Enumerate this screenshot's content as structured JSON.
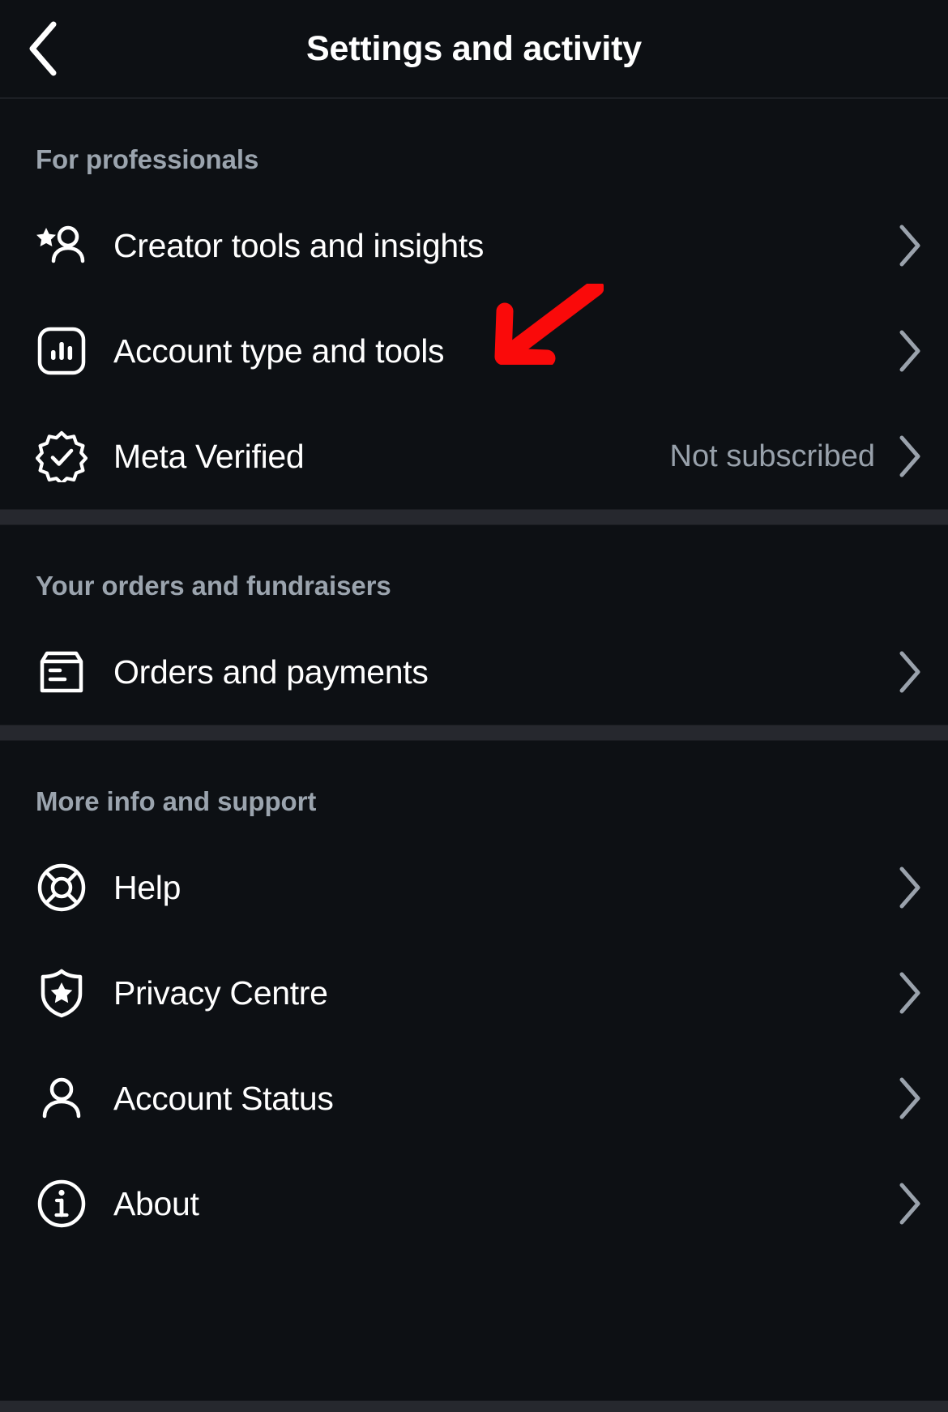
{
  "header": {
    "title": "Settings and activity",
    "back_icon": "chevron-left-icon"
  },
  "sections": [
    {
      "title": "For professionals",
      "items": [
        {
          "label": "Creator tools and insights",
          "icon": "creator-star-person-icon",
          "value": "",
          "chevron": "chevron-right-icon"
        },
        {
          "label": "Account type and tools",
          "icon": "bar-chart-square-icon",
          "value": "",
          "chevron": "chevron-right-icon"
        },
        {
          "label": "Meta Verified",
          "icon": "verified-badge-icon",
          "value": "Not subscribed",
          "chevron": "chevron-right-icon"
        }
      ]
    },
    {
      "title": "Your orders and fundraisers",
      "items": [
        {
          "label": "Orders and payments",
          "icon": "package-box-icon",
          "value": "",
          "chevron": "chevron-right-icon"
        }
      ]
    },
    {
      "title": "More info and support",
      "items": [
        {
          "label": "Help",
          "icon": "life-ring-icon",
          "value": "",
          "chevron": "chevron-right-icon"
        },
        {
          "label": "Privacy Centre",
          "icon": "shield-star-icon",
          "value": "",
          "chevron": "chevron-right-icon"
        },
        {
          "label": "Account Status",
          "icon": "person-icon",
          "value": "",
          "chevron": "chevron-right-icon"
        },
        {
          "label": "About",
          "icon": "info-circle-icon",
          "value": "",
          "chevron": "chevron-right-icon"
        }
      ]
    }
  ],
  "annotation": {
    "arrow_icon": "red-arrow-pointing-down-left",
    "arrow_color": "#fa0a0a",
    "target_label": "Account type and tools"
  },
  "colors": {
    "background": "#0d1014",
    "divider": "#26282e",
    "section_header_text": "#9ba4ae",
    "item_label_text": "#ffffff",
    "value_text": "#98a1ab",
    "chevron": "#9aa2ac"
  }
}
